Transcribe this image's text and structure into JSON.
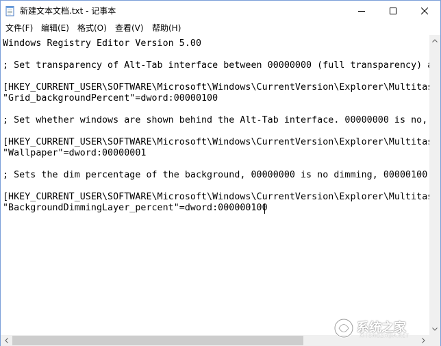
{
  "window": {
    "title": "新建文本文档.txt - 记事本"
  },
  "menu": [
    {
      "label": "文件(F)"
    },
    {
      "label": "编辑(E)"
    },
    {
      "label": "格式(O)"
    },
    {
      "label": "查看(V)"
    },
    {
      "label": "帮助(H)"
    }
  ],
  "editor": {
    "lines": [
      "Windows Registry Editor Version 5.00",
      "",
      "; Set transparency of Alt-Tab interface between 00000000 (full transparency) a",
      "",
      "[HKEY_CURRENT_USER\\SOFTWARE\\Microsoft\\Windows\\CurrentVersion\\Explorer\\Multitas",
      "\"Grid_backgroundPercent\"=dword:00000100",
      "",
      "; Set whether windows are shown behind the Alt-Tab interface. 00000000 is no,",
      "",
      "[HKEY_CURRENT_USER\\SOFTWARE\\Microsoft\\Windows\\CurrentVersion\\Explorer\\Multitas",
      "\"Wallpaper\"=dword:00000001",
      "",
      "; Sets the dim percentage of the background, 00000000 is no dimming, 00000100",
      "",
      "[HKEY_CURRENT_USER\\SOFTWARE\\Microsoft\\Windows\\CurrentVersion\\Explorer\\Multitas",
      "\"BackgroundDimmingLayer_percent\"=dword:000000100"
    ]
  },
  "watermark": {
    "text": "系统之家",
    "sub": "XITONGZHIJIA.NET"
  },
  "colors": {
    "window_border": "#7a9fd8",
    "scrollbar_bg": "#f0f0f0",
    "scroll_thumb": "#cdcdcd"
  }
}
